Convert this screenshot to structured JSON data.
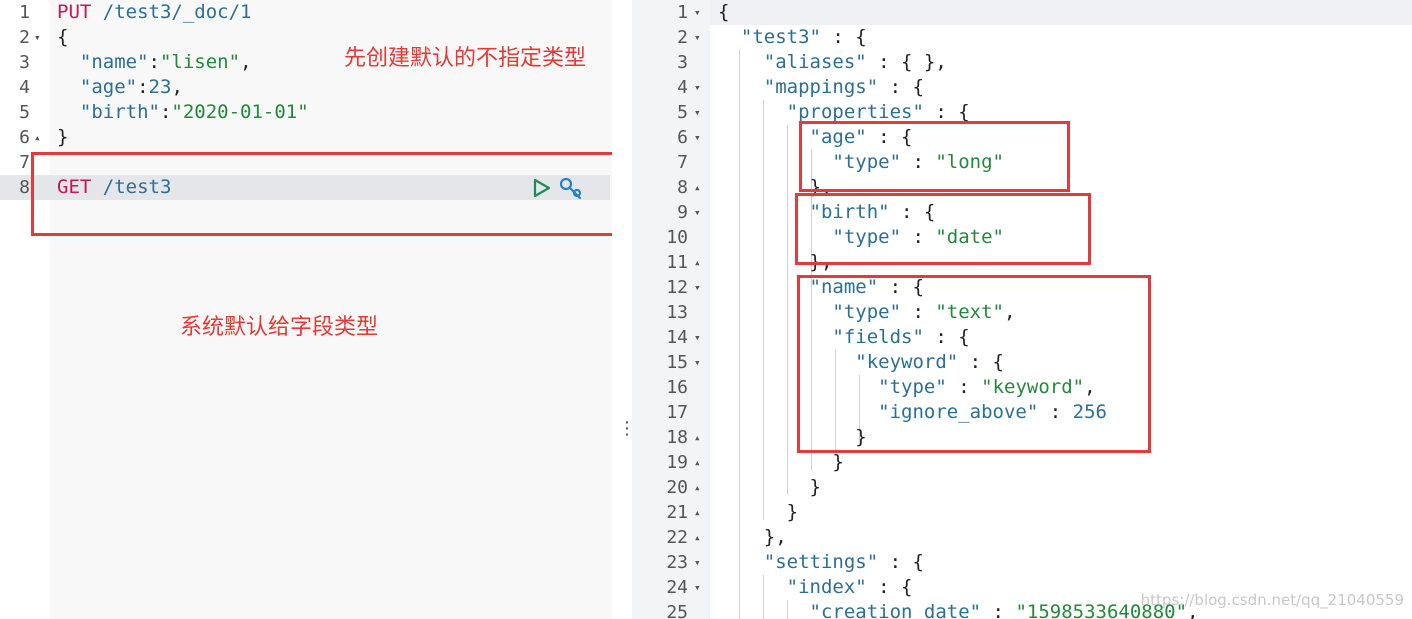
{
  "left_editor": {
    "lines": [
      {
        "ln": "1",
        "fold": "",
        "tokens": [
          {
            "t": "PUT",
            "c": "kw"
          },
          {
            "t": " ",
            "c": "punc"
          },
          {
            "t": "/test3/_doc/1",
            "c": "url"
          }
        ]
      },
      {
        "ln": "2",
        "fold": "▾",
        "tokens": [
          {
            "t": "{",
            "c": "punc"
          }
        ]
      },
      {
        "ln": "3",
        "fold": "",
        "tokens": [
          {
            "t": "  ",
            "c": "punc"
          },
          {
            "t": "\"name\"",
            "c": "key"
          },
          {
            "t": ":",
            "c": "punc"
          },
          {
            "t": "\"lisen\"",
            "c": "str"
          },
          {
            "t": ",",
            "c": "punc"
          }
        ]
      },
      {
        "ln": "4",
        "fold": "",
        "tokens": [
          {
            "t": "  ",
            "c": "punc"
          },
          {
            "t": "\"age\"",
            "c": "key"
          },
          {
            "t": ":",
            "c": "punc"
          },
          {
            "t": "23",
            "c": "num"
          },
          {
            "t": ",",
            "c": "punc"
          }
        ]
      },
      {
        "ln": "5",
        "fold": "",
        "tokens": [
          {
            "t": "  ",
            "c": "punc"
          },
          {
            "t": "\"birth\"",
            "c": "key"
          },
          {
            "t": ":",
            "c": "punc"
          },
          {
            "t": "\"2020-01-01\"",
            "c": "str"
          }
        ]
      },
      {
        "ln": "6",
        "fold": "▴",
        "tokens": [
          {
            "t": "}",
            "c": "punc"
          }
        ]
      },
      {
        "ln": "7",
        "fold": "",
        "tokens": []
      },
      {
        "ln": "8",
        "fold": "",
        "tokens": [
          {
            "t": "GET",
            "c": "kw"
          },
          {
            "t": " ",
            "c": "punc"
          },
          {
            "t": "/test3",
            "c": "url"
          }
        ]
      }
    ]
  },
  "right_editor": {
    "lines": [
      {
        "ln": "1",
        "fold": "▾",
        "tokens": [
          {
            "t": "{",
            "c": "punc"
          }
        ]
      },
      {
        "ln": "2",
        "fold": "▾",
        "tokens": [
          {
            "t": "  ",
            "c": "punc"
          },
          {
            "t": "\"test3\"",
            "c": "key"
          },
          {
            "t": " : {",
            "c": "punc"
          }
        ]
      },
      {
        "ln": "3",
        "fold": "",
        "tokens": [
          {
            "t": "    ",
            "c": "punc"
          },
          {
            "t": "\"aliases\"",
            "c": "key"
          },
          {
            "t": " : { },",
            "c": "punc"
          }
        ]
      },
      {
        "ln": "4",
        "fold": "▾",
        "tokens": [
          {
            "t": "    ",
            "c": "punc"
          },
          {
            "t": "\"mappings\"",
            "c": "key"
          },
          {
            "t": " : {",
            "c": "punc"
          }
        ]
      },
      {
        "ln": "5",
        "fold": "▾",
        "tokens": [
          {
            "t": "      ",
            "c": "punc"
          },
          {
            "t": "\"properties\"",
            "c": "key"
          },
          {
            "t": " : {",
            "c": "punc"
          }
        ]
      },
      {
        "ln": "6",
        "fold": "▾",
        "tokens": [
          {
            "t": "        ",
            "c": "punc"
          },
          {
            "t": "\"age\"",
            "c": "key"
          },
          {
            "t": " : {",
            "c": "punc"
          }
        ]
      },
      {
        "ln": "7",
        "fold": "",
        "tokens": [
          {
            "t": "          ",
            "c": "punc"
          },
          {
            "t": "\"type\"",
            "c": "key"
          },
          {
            "t": " : ",
            "c": "punc"
          },
          {
            "t": "\"long\"",
            "c": "str"
          }
        ]
      },
      {
        "ln": "8",
        "fold": "▴",
        "tokens": [
          {
            "t": "        },",
            "c": "punc"
          }
        ]
      },
      {
        "ln": "9",
        "fold": "▾",
        "tokens": [
          {
            "t": "        ",
            "c": "punc"
          },
          {
            "t": "\"birth\"",
            "c": "key"
          },
          {
            "t": " : {",
            "c": "punc"
          }
        ]
      },
      {
        "ln": "10",
        "fold": "",
        "tokens": [
          {
            "t": "          ",
            "c": "punc"
          },
          {
            "t": "\"type\"",
            "c": "key"
          },
          {
            "t": " : ",
            "c": "punc"
          },
          {
            "t": "\"date\"",
            "c": "str"
          }
        ]
      },
      {
        "ln": "11",
        "fold": "▴",
        "tokens": [
          {
            "t": "        },",
            "c": "punc"
          }
        ]
      },
      {
        "ln": "12",
        "fold": "▾",
        "tokens": [
          {
            "t": "        ",
            "c": "punc"
          },
          {
            "t": "\"name\"",
            "c": "key"
          },
          {
            "t": " : {",
            "c": "punc"
          }
        ]
      },
      {
        "ln": "13",
        "fold": "",
        "tokens": [
          {
            "t": "          ",
            "c": "punc"
          },
          {
            "t": "\"type\"",
            "c": "key"
          },
          {
            "t": " : ",
            "c": "punc"
          },
          {
            "t": "\"text\"",
            "c": "str"
          },
          {
            "t": ",",
            "c": "punc"
          }
        ]
      },
      {
        "ln": "14",
        "fold": "▾",
        "tokens": [
          {
            "t": "          ",
            "c": "punc"
          },
          {
            "t": "\"fields\"",
            "c": "key"
          },
          {
            "t": " : {",
            "c": "punc"
          }
        ]
      },
      {
        "ln": "15",
        "fold": "▾",
        "tokens": [
          {
            "t": "            ",
            "c": "punc"
          },
          {
            "t": "\"keyword\"",
            "c": "key"
          },
          {
            "t": " : {",
            "c": "punc"
          }
        ]
      },
      {
        "ln": "16",
        "fold": "",
        "tokens": [
          {
            "t": "              ",
            "c": "punc"
          },
          {
            "t": "\"type\"",
            "c": "key"
          },
          {
            "t": " : ",
            "c": "punc"
          },
          {
            "t": "\"keyword\"",
            "c": "str"
          },
          {
            "t": ",",
            "c": "punc"
          }
        ]
      },
      {
        "ln": "17",
        "fold": "",
        "tokens": [
          {
            "t": "              ",
            "c": "punc"
          },
          {
            "t": "\"ignore_above\"",
            "c": "key"
          },
          {
            "t": " : ",
            "c": "punc"
          },
          {
            "t": "256",
            "c": "num"
          }
        ]
      },
      {
        "ln": "18",
        "fold": "▴",
        "tokens": [
          {
            "t": "            }",
            "c": "punc"
          }
        ]
      },
      {
        "ln": "19",
        "fold": "▴",
        "tokens": [
          {
            "t": "          }",
            "c": "punc"
          }
        ]
      },
      {
        "ln": "20",
        "fold": "▴",
        "tokens": [
          {
            "t": "        }",
            "c": "punc"
          }
        ]
      },
      {
        "ln": "21",
        "fold": "▴",
        "tokens": [
          {
            "t": "      }",
            "c": "punc"
          }
        ]
      },
      {
        "ln": "22",
        "fold": "▴",
        "tokens": [
          {
            "t": "    },",
            "c": "punc"
          }
        ]
      },
      {
        "ln": "23",
        "fold": "▾",
        "tokens": [
          {
            "t": "    ",
            "c": "punc"
          },
          {
            "t": "\"settings\"",
            "c": "key"
          },
          {
            "t": " : {",
            "c": "punc"
          }
        ]
      },
      {
        "ln": "24",
        "fold": "▾",
        "tokens": [
          {
            "t": "      ",
            "c": "punc"
          },
          {
            "t": "\"index\"",
            "c": "key"
          },
          {
            "t": " : {",
            "c": "punc"
          }
        ]
      },
      {
        "ln": "25",
        "fold": "",
        "tokens": [
          {
            "t": "        ",
            "c": "punc"
          },
          {
            "t": "\"creation_date\"",
            "c": "key"
          },
          {
            "t": " : ",
            "c": "punc"
          },
          {
            "t": "\"1598533640880\"",
            "c": "str"
          },
          {
            "t": ",",
            "c": "punc"
          }
        ]
      }
    ]
  },
  "annotations": {
    "top": "先创建默认的不指定类型",
    "middle": "系统默认给字段类型"
  },
  "watermark": "https://blog.csdn.net/qq_21040559",
  "icons": {
    "run": "play-icon",
    "settings": "wrench-icon"
  },
  "colors": {
    "keyword": "#c2185b",
    "key": "#2a6f97",
    "string": "#218a3a",
    "highlight": "#e33b3b"
  }
}
